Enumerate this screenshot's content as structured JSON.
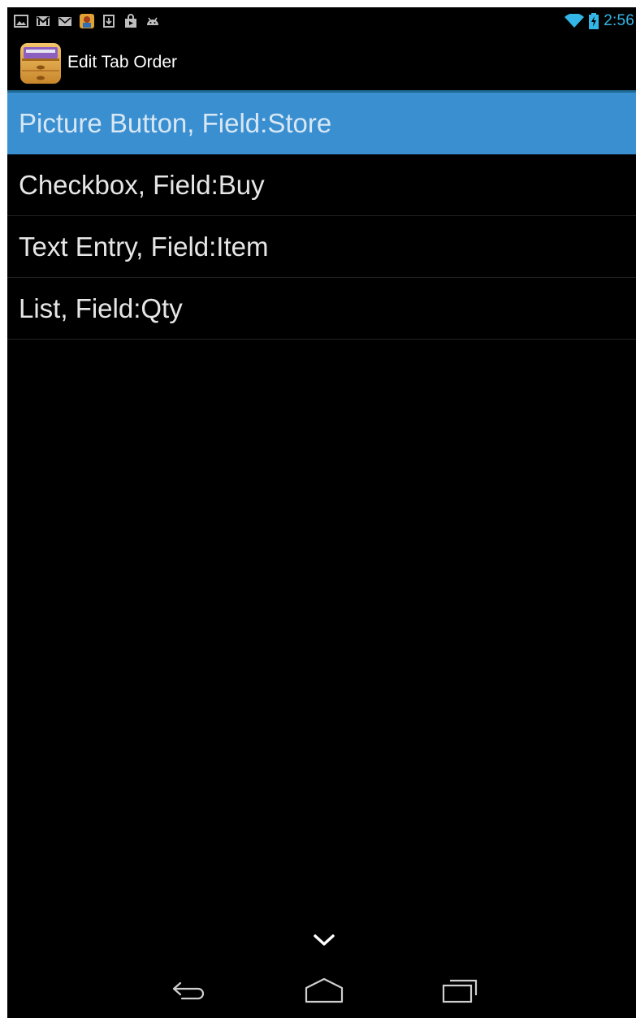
{
  "status_bar": {
    "time": "2:56",
    "notification_icons": [
      "gallery-icon",
      "gmail-icon",
      "email-icon",
      "game-app-icon",
      "download-icon",
      "shopping-bag-icon",
      "android-icon"
    ],
    "wifi_icon": "wifi-icon",
    "battery_icon": "battery-charging-icon",
    "accent_color": "#33b5e5"
  },
  "action_bar": {
    "title": "Edit Tab Order",
    "app_icon": "drawer-icon"
  },
  "list": {
    "selected_color": "#3a8fd1",
    "items": [
      {
        "label": "Picture Button, Field:Store",
        "selected": true
      },
      {
        "label": "Checkbox, Field:Buy",
        "selected": false
      },
      {
        "label": "Text Entry, Field:Item",
        "selected": false
      },
      {
        "label": "List, Field:Qty",
        "selected": false
      }
    ]
  },
  "navigation": {
    "hide_keyboard_icon": "chevron-down-icon",
    "back_icon": "back-icon",
    "home_icon": "home-icon",
    "recent_icon": "recent-apps-icon"
  }
}
